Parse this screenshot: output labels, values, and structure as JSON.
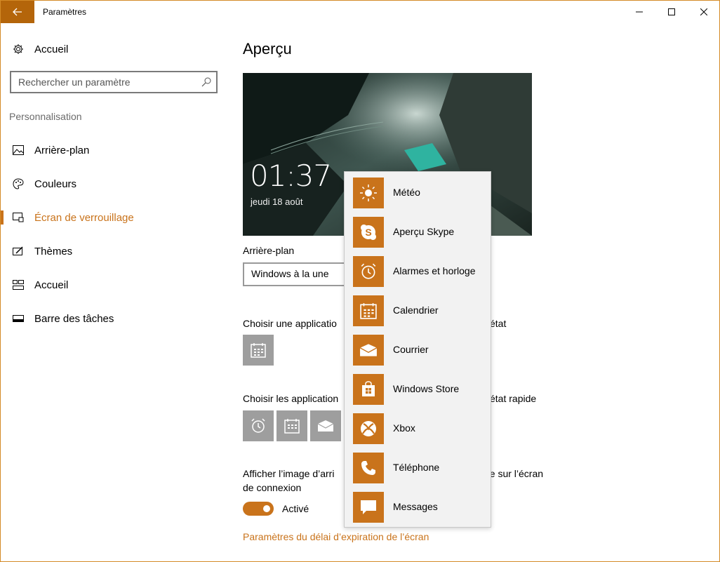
{
  "window": {
    "title": "Paramètres"
  },
  "sidebar": {
    "home_label": "Accueil",
    "search_placeholder": "Rechercher un paramètre",
    "section_label": "Personnalisation",
    "items": [
      {
        "label": "Arrière-plan",
        "icon": "image-icon"
      },
      {
        "label": "Couleurs",
        "icon": "palette-icon"
      },
      {
        "label": "Écran de verrouillage",
        "icon": "lock-screen-icon",
        "active": true
      },
      {
        "label": "Thèmes",
        "icon": "themes-icon"
      },
      {
        "label": "Accueil",
        "icon": "start-icon"
      },
      {
        "label": "Barre des tâches",
        "icon": "taskbar-icon"
      }
    ]
  },
  "main": {
    "title": "Aperçu",
    "preview_time": "01:37",
    "preview_date": "jeudi 18 août",
    "background_label": "Arrière-plan",
    "background_value": "Windows à la une",
    "detailed_status_label": "Choisir une applicatio",
    "detailed_status_label_tail": "état",
    "quick_status_label": "Choisir les application",
    "quick_status_label_tail": "état rapide",
    "signin_label_line1_head": "Afficher l’image d’arri",
    "signin_label_line1_tail": "ge sur l’écran",
    "signin_label_line2": "de connexion",
    "toggle_label": "Activé",
    "timeout_link": "Paramètres du délai d’expiration de l’écran",
    "toggle_on": true
  },
  "flyout": {
    "items": [
      {
        "label": "Météo",
        "icon": "sun-icon"
      },
      {
        "label": "Aperçu Skype",
        "icon": "skype-icon"
      },
      {
        "label": "Alarmes et horloge",
        "icon": "alarm-clock-icon"
      },
      {
        "label": "Calendrier",
        "icon": "calendar-icon"
      },
      {
        "label": "Courrier",
        "icon": "mail-icon"
      },
      {
        "label": "Windows Store",
        "icon": "store-icon"
      },
      {
        "label": "Xbox",
        "icon": "xbox-icon"
      },
      {
        "label": "Téléphone",
        "icon": "phone-icon"
      },
      {
        "label": "Messages",
        "icon": "message-icon"
      }
    ]
  },
  "colors": {
    "accent": "#c9731b",
    "back_button": "#b4650a",
    "slot_grey": "#9e9e9e"
  }
}
